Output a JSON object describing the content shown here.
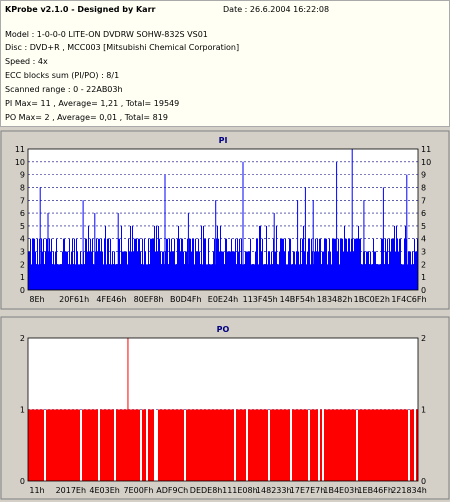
{
  "header": {
    "title": "KProbe v2.1.0 - Designed by Karr",
    "date": "Date : 26.6.2004 16:22:08",
    "lines": [
      "Model : 1-0-0-0 LITE-ON DVDRW SOHW-832S  VS01",
      "Disc : DVD+R , MCC003 [Mitsubishi Chemical Corporation]",
      "Speed : 4x",
      "ECC blocks sum (PI/PO) : 8/1",
      "Scanned range : 0 - 22AB03h",
      "PI Max= 11 , Average= 1,21 , Total= 19549",
      "PO Max= 2 , Average= 0,01 , Total= 819"
    ]
  },
  "chart_data": [
    {
      "type": "bar",
      "title": "PI",
      "ylim": [
        0,
        11
      ],
      "yticks": [
        0,
        1,
        2,
        3,
        4,
        5,
        6,
        7,
        8,
        9,
        10,
        11
      ],
      "xticks": [
        "8Eh",
        "20F61h",
        "4FE46h",
        "80EF8h",
        "B0D4Fh",
        "E0E24h",
        "113F45h",
        "14BF54h",
        "183482h",
        "1BC0E2h",
        "1F4C6Fh"
      ],
      "color": "#0000ff",
      "baseline": 2,
      "typical_max": 4,
      "spikes": [
        {
          "x": 0.03,
          "value": 8
        },
        {
          "x": 0.05,
          "value": 6
        },
        {
          "x": 0.14,
          "value": 7
        },
        {
          "x": 0.17,
          "value": 6
        },
        {
          "x": 0.23,
          "value": 6
        },
        {
          "x": 0.35,
          "value": 9
        },
        {
          "x": 0.41,
          "value": 6
        },
        {
          "x": 0.48,
          "value": 7
        },
        {
          "x": 0.55,
          "value": 10
        },
        {
          "x": 0.63,
          "value": 6
        },
        {
          "x": 0.69,
          "value": 7
        },
        {
          "x": 0.71,
          "value": 8
        },
        {
          "x": 0.73,
          "value": 7
        },
        {
          "x": 0.79,
          "value": 10
        },
        {
          "x": 0.83,
          "value": 11
        },
        {
          "x": 0.86,
          "value": 7
        },
        {
          "x": 0.91,
          "value": 8
        },
        {
          "x": 0.97,
          "value": 9
        }
      ]
    },
    {
      "type": "bar",
      "title": "PO",
      "ylim": [
        0,
        2
      ],
      "yticks": [
        0,
        1,
        2
      ],
      "xticks": [
        "11h",
        "2017Eh",
        "4E03Eh",
        "7E00Fh",
        "ADF9Ch",
        "DEDE8h",
        "111E08h",
        "148233h",
        "17E7E7h",
        "1B4E03h",
        "1EB46Fh",
        "221834h"
      ],
      "color": "#ff0000",
      "base_value": 1,
      "spike": {
        "x": 0.255,
        "value": 2
      }
    }
  ]
}
